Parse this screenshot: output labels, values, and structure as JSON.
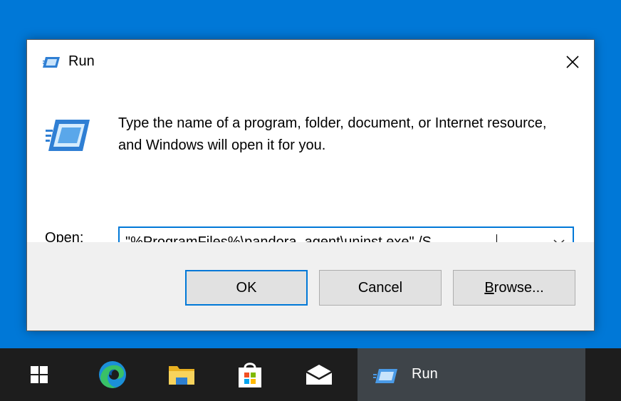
{
  "dialog": {
    "title": "Run",
    "description": "Type the name of a program, folder, document, or Internet resource, and Windows will open it for you.",
    "open_label_accel": "O",
    "open_label_rest": "pen:",
    "command_value": "\"%ProgramFiles%\\pandora_agent\\uninst.exe\" /S",
    "ok_label": "OK",
    "cancel_label": "Cancel",
    "browse_label_accel": "B",
    "browse_label_rest": "rowse..."
  },
  "taskbar": {
    "pinned": [
      "windows-start-icon",
      "edge-icon",
      "file-explorer-icon",
      "microsoft-store-icon",
      "mail-icon"
    ],
    "active_window_label": "Run"
  },
  "colors": {
    "desktop": "#0078d7",
    "accent": "#0078d7",
    "taskbar": "#1d1d1d",
    "taskbar_active": "#3e4449"
  }
}
